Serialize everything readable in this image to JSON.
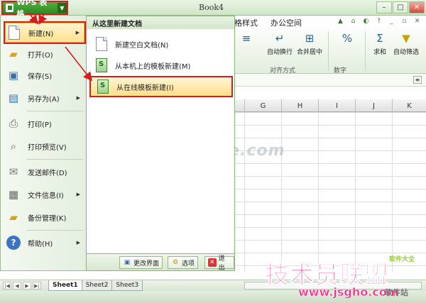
{
  "app": {
    "menu_label": "WPS 表格",
    "caret": "▼",
    "doc_title": "Book4"
  },
  "window_controls": [
    "–",
    "□",
    "✕"
  ],
  "ribbon": {
    "tabs": [
      "格样式",
      "办公空间"
    ],
    "buttons": [
      {
        "label": "自动换行",
        "icon": "wrap-text-icon"
      },
      {
        "label": "合并居中",
        "icon": "merge-center-icon"
      },
      {
        "label": "%",
        "icon": "percent-icon"
      },
      {
        "label": "求和",
        "icon": "sum-icon"
      },
      {
        "label": "自动筛选",
        "icon": "filter-icon"
      }
    ],
    "groups": [
      "对齐方式",
      "数字"
    ]
  },
  "grid": {
    "columns": [
      "G",
      "H",
      "I",
      "J",
      "K"
    ]
  },
  "file_menu": {
    "items": [
      {
        "label": "新建(N)",
        "has_submenu": true
      },
      {
        "label": "打开(O)",
        "has_submenu": false
      },
      {
        "label": "保存(S)",
        "has_submenu": false
      },
      {
        "label": "另存为(A)",
        "has_submenu": true
      },
      {
        "label": "打印(P)",
        "has_submenu": false
      },
      {
        "label": "打印预览(V)",
        "has_submenu": false
      },
      {
        "label": "发送邮件(D)",
        "has_submenu": false
      },
      {
        "label": "文件信息(I)",
        "has_submenu": true
      },
      {
        "label": "备份管理(K)",
        "has_submenu": false
      },
      {
        "label": "帮助(H)",
        "has_submenu": true
      }
    ]
  },
  "submenu": {
    "header": "从这里新建文档",
    "items": [
      {
        "label": "新建空白文档(N)"
      },
      {
        "label": "从本机上的模板新建(M)"
      },
      {
        "label": "从在线模板新建(I)"
      }
    ]
  },
  "footer": {
    "change_ui": "更改界面",
    "options": "选项",
    "exit": "退出"
  },
  "sheets": [
    "Sheet1",
    "Sheet2",
    "Sheet3"
  ],
  "watermark": "www.DuoTe.com",
  "brand": {
    "name": "技术员联盟",
    "url": "www.jsgho.com",
    "small_top": "软件大全",
    "small_bottom": "软件站"
  }
}
